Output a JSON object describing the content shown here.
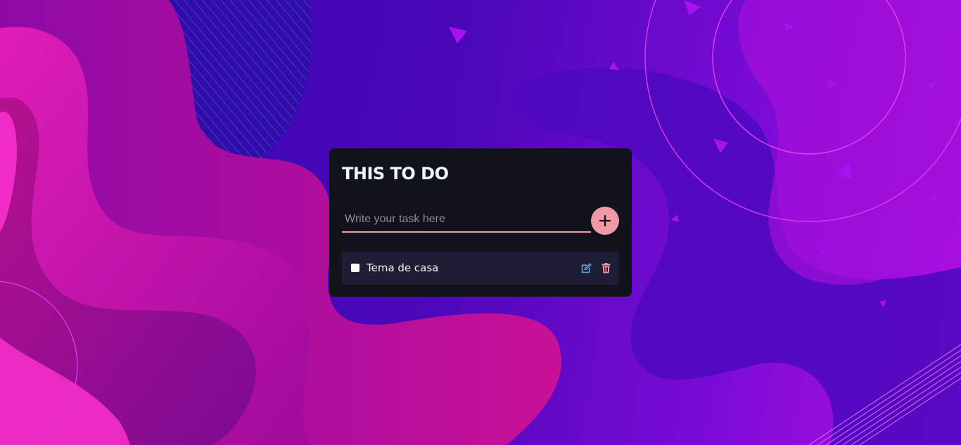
{
  "app": {
    "title": "THIS TO DO"
  },
  "new_task": {
    "placeholder": "Write your task here",
    "value": ""
  },
  "tasks": [
    {
      "text": "Tema de casa",
      "done": false
    }
  ],
  "colors": {
    "card_background": "#11131b",
    "accent": "#ee99a6",
    "task_background": "#1d1e35",
    "edit_icon": "#5aa0d8",
    "delete_icon": "#ee99a6"
  },
  "icons": {
    "add": "plus-icon",
    "edit": "edit-icon",
    "delete": "trash-icon"
  }
}
